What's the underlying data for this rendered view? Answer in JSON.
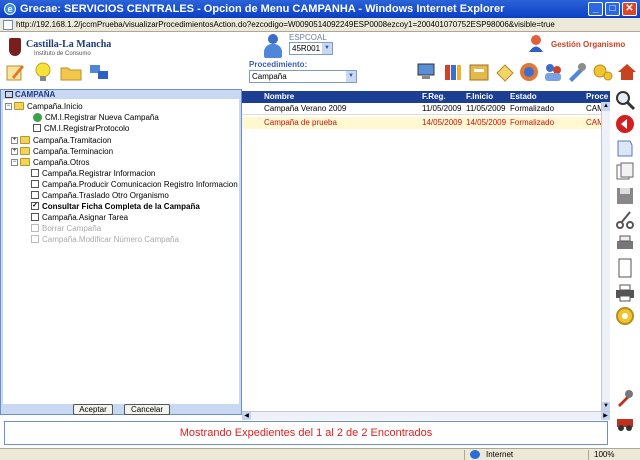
{
  "window": {
    "title": "Grecae: SERVICIOS CENTRALES - Opcion de Menu CAMPANHA - Windows Internet Explorer",
    "url": "http://192.168.1.2/jccmPrueba/visualizarProcedimientosAction.do?ezcodigo=W0090514092249ESP0008ezcoy1=200401070752ESP98006&visible=true"
  },
  "header": {
    "logo_text": "Castilla-La Mancha",
    "logo_sub": "Instituto de Consumo",
    "user_label": "ESPCOAL",
    "user_value": "45R001",
    "gestion_label": "Gestión Organismo"
  },
  "procedure": {
    "label": "Procedimiento:",
    "value": "Campaña"
  },
  "tree": {
    "root": "CAMPAÑA",
    "nodes": [
      {
        "label": "Campaña.Inicio"
      },
      {
        "label": "CM.I.Registrar Nueva Campaña"
      },
      {
        "label": "CM.I.RegistrarProtocolo"
      },
      {
        "label": "Campaña.Tramitacion"
      },
      {
        "label": "Campaña.Terminacion"
      },
      {
        "label": "Campaña.Otros"
      },
      {
        "label": "Campaña.Registrar Informacion"
      },
      {
        "label": "Campaña.Producir Comunicacion Registro Informacion"
      },
      {
        "label": "Campaña.Traslado Otro Organismo"
      },
      {
        "label": "Consultar Ficha Completa de la Campaña"
      },
      {
        "label": "Campaña.Asignar Tarea"
      },
      {
        "label": "Borrar Campaña"
      },
      {
        "label": "Campaña.Modificar Número Campaña"
      }
    ],
    "accept_label": "Aceptar",
    "cancel_label": "Cancelar"
  },
  "table": {
    "headers": [
      "Nombre",
      "F.Reg.",
      "F.Inicio",
      "Estado",
      "Proce"
    ],
    "rows": [
      [
        "Campaña Verano 2009",
        "11/05/2009",
        "11/05/2009",
        "Formalizado",
        "CAMP"
      ],
      [
        "Campaña de prueba",
        "14/05/2009",
        "14/05/2009",
        "Formalizado",
        "CAMP"
      ]
    ]
  },
  "status_message": "Mostrando Expedientes del 1 al 2 de 2 Encontrados",
  "ie_status": {
    "zone": "Internet",
    "zoom": "100%"
  },
  "colors": {
    "title_bar": "#0a3fc4",
    "table_header": "#1c3f94",
    "highlight_row": "#fff8d0",
    "status_text": "#e02020",
    "tree_panel": "#c8d8f2"
  },
  "icons": [
    "internet-explorer-icon",
    "castilla-la-mancha-crest-icon",
    "user-icon",
    "gestion-organismo-icon",
    "toolbar-edit-icon",
    "toolbar-bulb-icon",
    "toolbar-folder-icon",
    "toolbar-network-icon",
    "search-icon",
    "back-icon",
    "print-icon",
    "settings-gear-icon"
  ]
}
